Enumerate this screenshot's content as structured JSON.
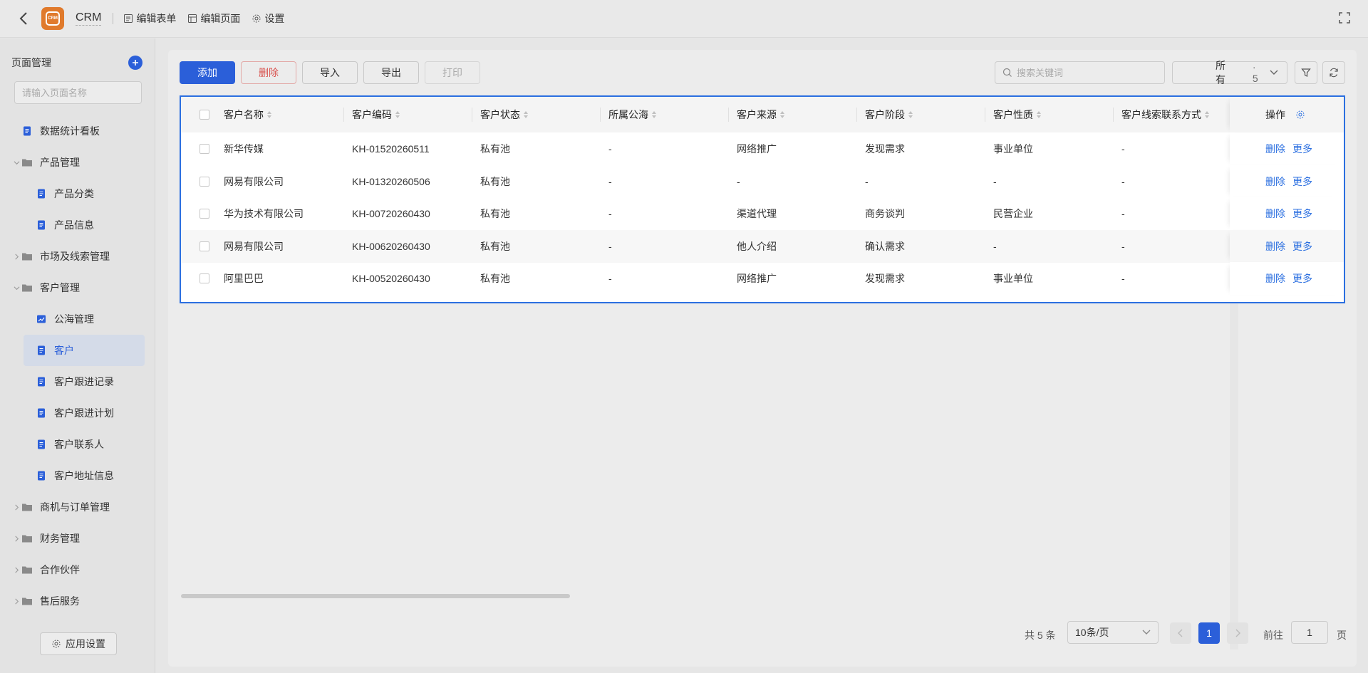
{
  "topbar": {
    "app_name": "CRM",
    "logo_text": "CRM",
    "links": [
      {
        "label": "编辑表单",
        "icon": "form-icon"
      },
      {
        "label": "编辑页面",
        "icon": "layout-icon"
      },
      {
        "label": "设置",
        "icon": "gear-icon"
      }
    ]
  },
  "sidebar": {
    "title": "页面管理",
    "search_placeholder": "请输入页面名称",
    "items": [
      {
        "label": "数据统计看板",
        "type": "page",
        "level": 0
      },
      {
        "label": "产品管理",
        "type": "folder",
        "level": 0,
        "expanded": true
      },
      {
        "label": "产品分类",
        "type": "page",
        "level": 1
      },
      {
        "label": "产品信息",
        "type": "page",
        "level": 1
      },
      {
        "label": "市场及线索管理",
        "type": "folder",
        "level": 0,
        "expanded": false
      },
      {
        "label": "客户管理",
        "type": "folder",
        "level": 0,
        "expanded": true
      },
      {
        "label": "公海管理",
        "type": "chart",
        "level": 1
      },
      {
        "label": "客户",
        "type": "page",
        "level": 1,
        "active": true
      },
      {
        "label": "客户跟进记录",
        "type": "page",
        "level": 1
      },
      {
        "label": "客户跟进计划",
        "type": "page",
        "level": 1
      },
      {
        "label": "客户联系人",
        "type": "page",
        "level": 1
      },
      {
        "label": "客户地址信息",
        "type": "page",
        "level": 1
      },
      {
        "label": "商机与订单管理",
        "type": "folder",
        "level": 0,
        "expanded": false
      },
      {
        "label": "财务管理",
        "type": "folder",
        "level": 0,
        "expanded": false
      },
      {
        "label": "合作伙伴",
        "type": "folder",
        "level": 0,
        "expanded": false
      },
      {
        "label": "售后服务",
        "type": "folder",
        "level": 0,
        "expanded": false
      }
    ],
    "app_settings_label": "应用设置"
  },
  "toolbar": {
    "add_label": "添加",
    "delete_label": "删除",
    "import_label": "导入",
    "export_label": "导出",
    "print_label": "打印",
    "search_placeholder": "搜索关键词",
    "scope_label": "所有",
    "scope_count": "5"
  },
  "table": {
    "columns": [
      "客户名称",
      "客户编码",
      "客户状态",
      "所属公海",
      "客户来源",
      "客户阶段",
      "客户性质",
      "客户线索联系方式"
    ],
    "op_header": "操作",
    "op_delete": "删除",
    "op_more": "更多",
    "rows": [
      [
        "新华传媒",
        "KH-01520260511",
        "私有池",
        "-",
        "网络推广",
        "发现需求",
        "事业单位",
        "-"
      ],
      [
        "网易有限公司",
        "KH-01320260506",
        "私有池",
        "-",
        "-",
        "-",
        "-",
        "-"
      ],
      [
        "华为技术有限公司",
        "KH-00720260430",
        "私有池",
        "-",
        "渠道代理",
        "商务谈判",
        "民营企业",
        "-"
      ],
      [
        "网易有限公司",
        "KH-00620260430",
        "私有池",
        "-",
        "他人介绍",
        "确认需求",
        "-",
        "-"
      ],
      [
        "阿里巴巴",
        "KH-00520260430",
        "私有池",
        "-",
        "网络推广",
        "发现需求",
        "事业单位",
        "-"
      ]
    ]
  },
  "pagination": {
    "total_label": "共 5 条",
    "page_size_label": "10条/页",
    "current_page": "1",
    "goto_label": "前往",
    "goto_value": "1",
    "goto_suffix": "页"
  },
  "colors": {
    "primary": "#2b5fd9",
    "link": "#2b6fe0",
    "danger": "#d9534f",
    "logo": "#e07a2c"
  }
}
